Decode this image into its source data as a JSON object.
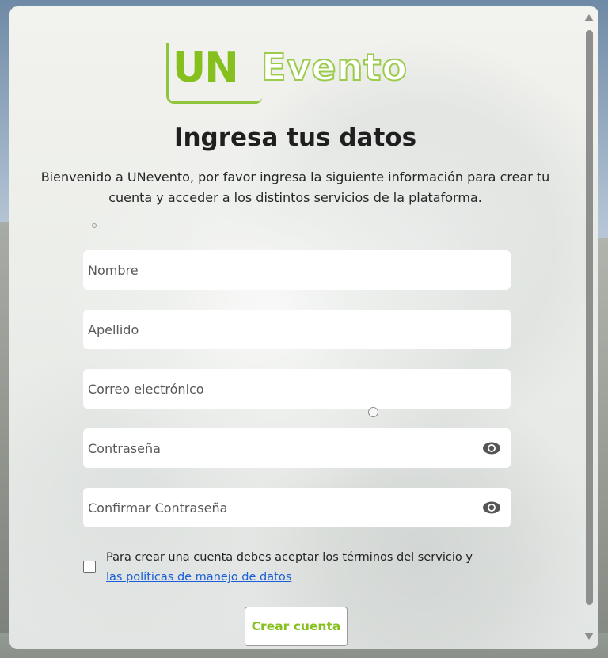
{
  "logo": {
    "part1": "UN",
    "part2": "Evento",
    "accent_color": "#86c01f"
  },
  "form": {
    "title": "Ingresa tus datos",
    "intro": "Bienvenido a UNevento, por favor ingresa la siguiente información para crear tu cuenta y acceder a los distintos servicios de la plataforma.",
    "fields": {
      "first_name": {
        "placeholder": "Nombre",
        "value": ""
      },
      "last_name": {
        "placeholder": "Apellido",
        "value": ""
      },
      "email": {
        "placeholder": "Correo electrónico",
        "value": ""
      },
      "password": {
        "placeholder": "Contraseña",
        "value": "",
        "icon": "eye-icon"
      },
      "confirm_password": {
        "placeholder": "Confirmar Contraseña",
        "value": "",
        "icon": "eye-icon"
      }
    },
    "terms": {
      "checked": false,
      "text": "Para crear una cuenta debes aceptar los términos del servicio y ",
      "link_text": "las políticas de manejo de datos"
    },
    "submit_label": "Crear cuenta"
  }
}
